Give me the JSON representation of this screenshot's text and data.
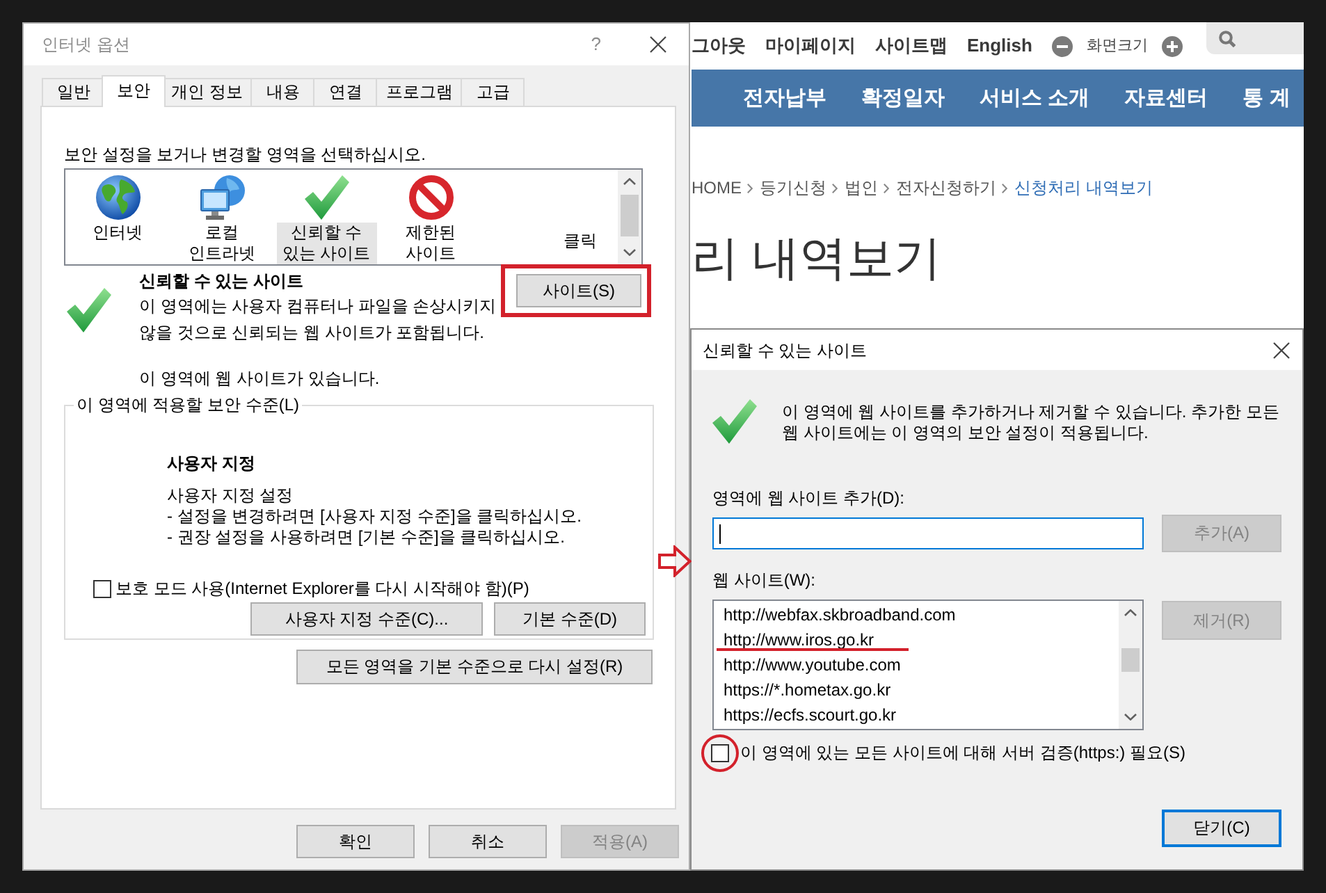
{
  "internet_options": {
    "title": "인터넷 옵션",
    "help_label": "?",
    "tabs": [
      {
        "label": "일반",
        "selected": false
      },
      {
        "label": "보안",
        "selected": true
      },
      {
        "label": "개인 정보",
        "selected": false
      },
      {
        "label": "내용",
        "selected": false
      },
      {
        "label": "연결",
        "selected": false
      },
      {
        "label": "프로그램",
        "selected": false
      },
      {
        "label": "고급",
        "selected": false
      }
    ],
    "instruction": "보안 설정을 보거나 변경할 영역을 선택하십시오.",
    "zones": [
      {
        "kind": "internet",
        "label": "인터넷",
        "selected": false
      },
      {
        "kind": "intranet",
        "label": "로컬 인트라넷",
        "selected": false
      },
      {
        "kind": "trusted",
        "label": "신뢰할 수 있는 사이트",
        "selected": true
      },
      {
        "kind": "restricted",
        "label": "제한된 사이트",
        "selected": false
      }
    ],
    "zone_note": "클릭",
    "zone_info": {
      "title": "신뢰할 수 있는 사이트",
      "description": "이 영역에는 사용자 컴퓨터나 파일을 손상시키지 않을 것으로 신뢰되는 웹 사이트가 포함됩니다.",
      "status": "이 영역에 웹 사이트가 있습니다.",
      "sites_button": {
        "label": "사이트(S)",
        "annotated": true
      }
    },
    "security_level": {
      "label": "이 영역에 적용할 보안 수준(L)",
      "level_name": "사용자 지정",
      "details": [
        "사용자 지정 설정",
        "- 설정을 변경하려면 [사용자 지정 수준]을 클릭하십시오.",
        "- 권장 설정을 사용하려면 [기본 수준]을 클릭하십시오."
      ],
      "protected_mode": {
        "label": "보호 모드 사용(Internet Explorer를 다시 시작해야 함)(P)",
        "checked": false
      },
      "buttons": [
        "사용자 지정 수준(C)...",
        "기본 수준(D)"
      ]
    },
    "reset_button": "모든 영역을 기본 수준으로 다시 설정(R)",
    "footer_buttons": [
      {
        "label": "확인",
        "disabled": false
      },
      {
        "label": "취소",
        "disabled": false
      },
      {
        "label": "적용(A)",
        "disabled": true
      }
    ]
  },
  "web_page": {
    "utility_links": [
      "그아웃",
      "마이페이지",
      "사이트맵",
      "English"
    ],
    "font_size_label": "화면크기",
    "nav_items": [
      "전자납부",
      "확정일자",
      "서비스 소개",
      "자료센터",
      "통 계"
    ],
    "breadcrumb": [
      {
        "label": "HOME",
        "current": false
      },
      {
        "label": "등기신청",
        "current": false
      },
      {
        "label": "법인",
        "current": false
      },
      {
        "label": "전자신청하기",
        "current": false
      },
      {
        "label": "신청처리 내역보기",
        "current": true
      }
    ],
    "heading": "리 내역보기"
  },
  "trusted_sites": {
    "title": "신뢰할 수 있는 사이트",
    "message": "이 영역에 웹 사이트를 추가하거나 제거할 수 있습니다. 추가한 모든 웹 사이트에는 이 영역의 보안 설정이 적용됩니다.",
    "add_label": "영역에 웹 사이트 추가(D):",
    "add_field": {
      "focused": true
    },
    "add_button": {
      "label": "추가(A)",
      "disabled": true
    },
    "list_label": "웹 사이트(W):",
    "sites": [
      {
        "url": "http://webfax.skbroadband.com",
        "annotated": false
      },
      {
        "url": "http://www.iros.go.kr",
        "annotated": true
      },
      {
        "url": "http://www.youtube.com",
        "annotated": false
      },
      {
        "url": "https://*.hometax.go.kr",
        "annotated": false
      },
      {
        "url": "https://ecfs.scourt.go.kr",
        "annotated": false
      }
    ],
    "remove_button": {
      "label": "제거(R)",
      "disabled": true
    },
    "https_check": {
      "label": "이 영역에 있는 모든 사이트에 대해 서버 검증(https:) 필요(S)",
      "checked": false,
      "annotated": true
    },
    "close_button": {
      "label": "닫기(C)",
      "default": true
    }
  }
}
